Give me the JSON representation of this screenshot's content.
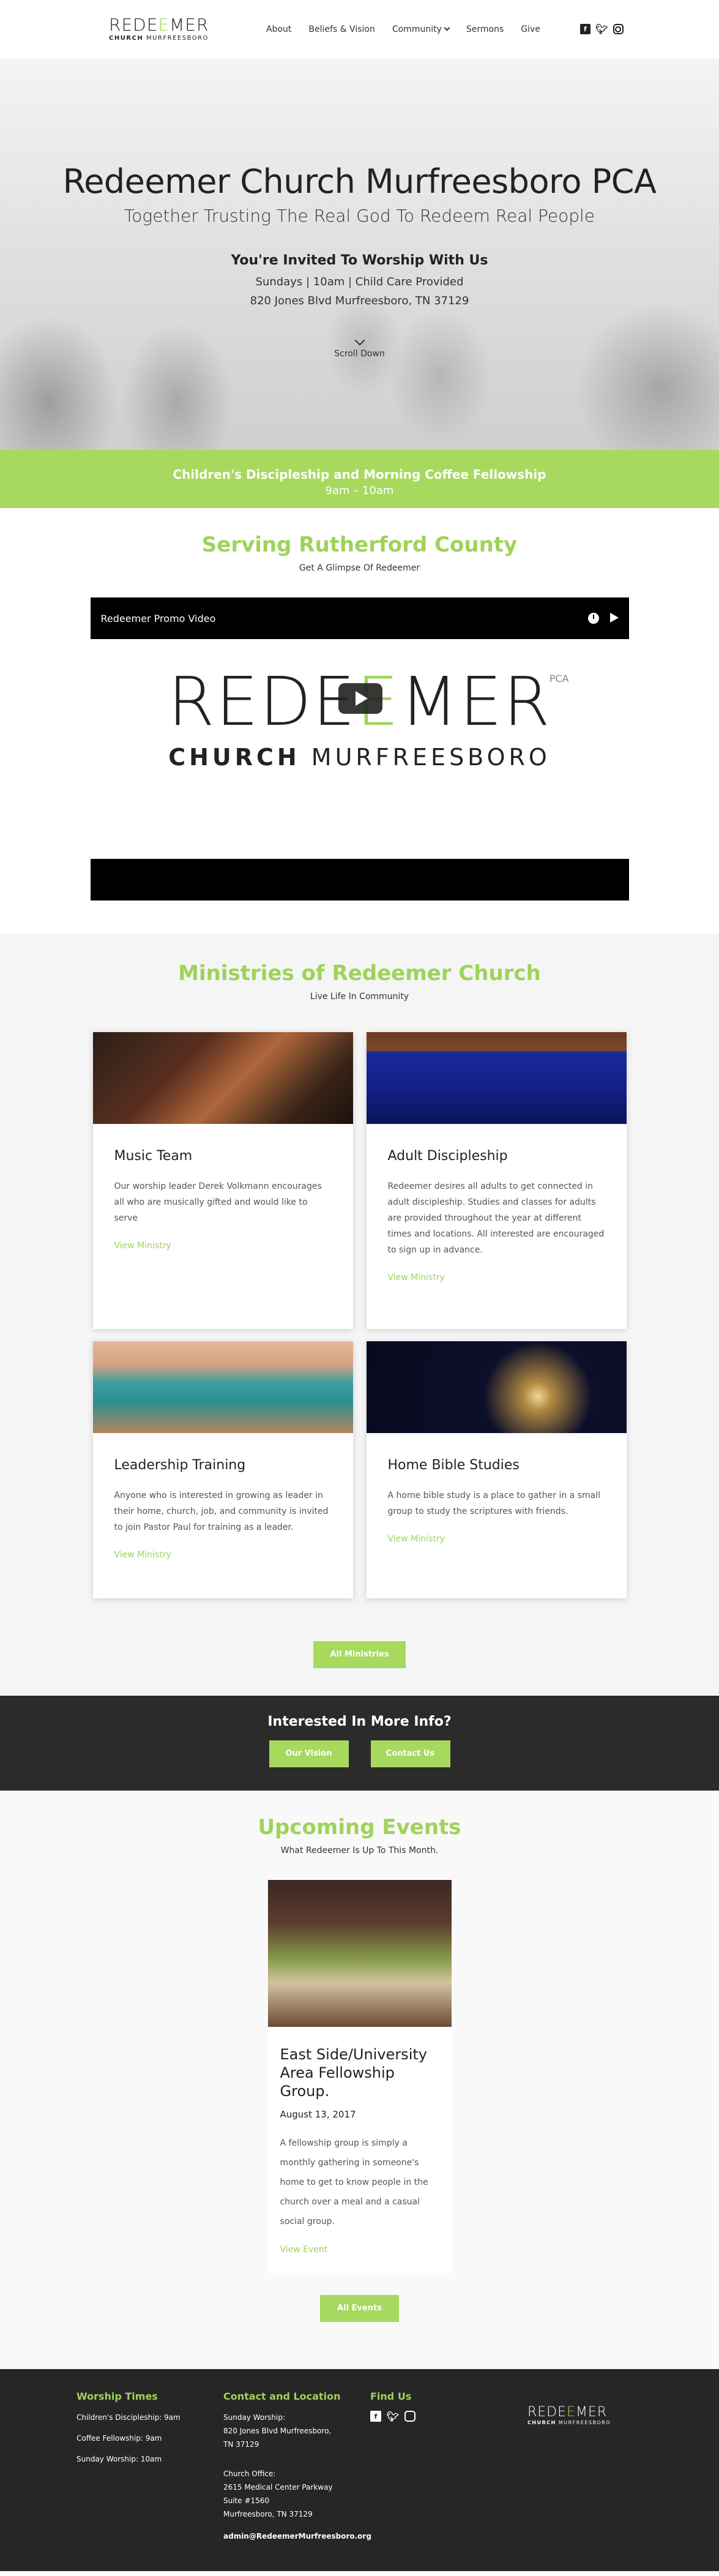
{
  "header": {
    "logo_word_a": "RED",
    "logo_word_b": "E",
    "logo_word_c": "E",
    "logo_word_d": "MER",
    "logo_sub_bold": "CHURCH",
    "logo_sub": "MURFREESBORO",
    "nav": [
      "About",
      "Beliefs & Vision",
      "Community",
      "Sermons",
      "Give"
    ],
    "social_icons": [
      "facebook-icon",
      "twitter-icon",
      "instagram-icon"
    ]
  },
  "hero": {
    "title": "Redeemer Church Murfreesboro PCA",
    "tagline": "Together Trusting The Real God To Redeem Real People",
    "invite": "You're Invited To Worship With Us",
    "schedule": "Sundays | 10am | Child Care Provided",
    "address": "820 Jones Blvd Murfreesboro, TN 37129",
    "scroll": "Scroll Down"
  },
  "banner": {
    "title": "Children's Discipleship and Morning Coffee Fellowship",
    "time": "9am – 10am"
  },
  "serving": {
    "title": "Serving Rutherford County",
    "subtitle": "Get A Glimpse Of Redeemer",
    "video_title": "Redeemer Promo Video",
    "video_logo_a": "RED",
    "video_logo_b": "E",
    "video_logo_c": "E",
    "video_logo_d": "MER",
    "video_logo_pca": "PCA",
    "video_logo_sub_bold": "CHURCH",
    "video_logo_sub": "MURFREESBORO"
  },
  "ministries": {
    "title": "Ministries of Redeemer Church",
    "subtitle": "Live Life In Community",
    "cards": [
      {
        "title": "Music Team",
        "text": "Our worship leader Derek Volkmann encourages all who are musically gifted and would like to serve",
        "link": "View Ministry"
      },
      {
        "title": "Adult Discipleship",
        "text": "Redeemer desires all adults to get connected in adult discipleship. Studies and classes for adults are provided throughout the year at different times and locations. All interested are encouraged to sign up in advance.",
        "link": "View Ministry"
      },
      {
        "title": "Leadership Training",
        "text": "Anyone who is interested in growing as leader in their home, church, job, and community is invited to join Pastor Paul for training as a leader.",
        "link": "View Ministry"
      },
      {
        "title": "Home Bible Studies",
        "text": "A home bible study is a place to gather in a small group to study the scriptures with friends.",
        "link": "View Ministry"
      }
    ],
    "all_button": "All Ministries"
  },
  "info": {
    "title": "Interested In More Info?",
    "btn_vision": "Our Vision",
    "btn_contact": "Contact Us"
  },
  "events": {
    "title": "Upcoming Events",
    "subtitle": "What Redeemer Is Up To This Month.",
    "event": {
      "title": "East Side/University Area Fellowship Group.",
      "date": "August 13, 2017",
      "text": "A fellowship group is simply a monthly gathering in someone's home to get to know people in the church over a meal and a casual social group.",
      "link": "View Event"
    },
    "all_button": "All Events"
  },
  "footer": {
    "worship_title": "Worship Times",
    "worship": [
      "Children's Discipleship: 9am",
      "Coffee Fellowship: 9am",
      "Sunday Worship: 10am"
    ],
    "contact_title": "Contact and Location",
    "sunday_label": "Sunday Worship:",
    "sunday_addr1": "820 Jones Blvd Murfreesboro,",
    "sunday_addr2": "TN 37129",
    "office_label": "Church Office:",
    "office_addr1": "2615 Medical Center Parkway",
    "office_addr2": "Suite #1560",
    "office_addr3": "Murfreesboro, TN 37129",
    "email": "admin@RedeemerMurfreesboro.org",
    "find_title": "Find Us",
    "logo_a": "RED",
    "logo_b": "E",
    "logo_c": "E",
    "logo_d": "MER",
    "logo_sub_bold": "CHURCH",
    "logo_sub": "MURFREESBORO"
  },
  "colors": {
    "accent": "#a7d95f",
    "dark": "#2b2b2b",
    "footer": "#262626"
  }
}
